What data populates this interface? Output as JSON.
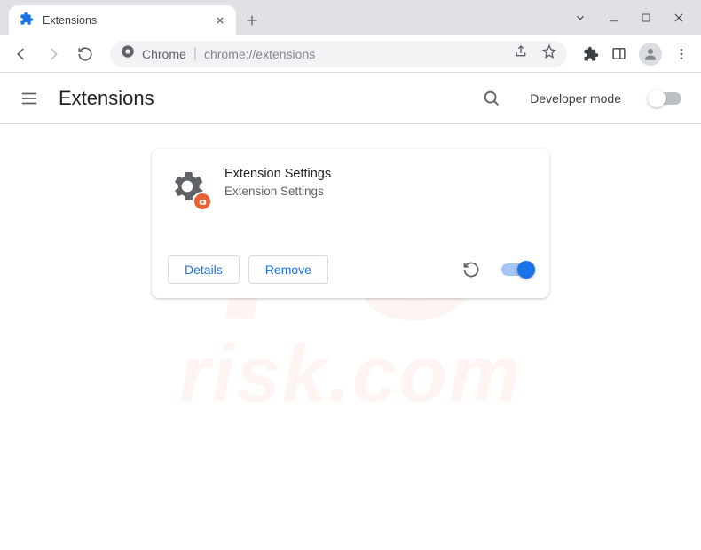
{
  "titlebar": {
    "tab_title": "Extensions"
  },
  "omnibox": {
    "scheme_label": "Chrome",
    "url_path": "chrome://extensions"
  },
  "page": {
    "title": "Extensions",
    "dev_mode_label": "Developer mode",
    "dev_mode_on": false
  },
  "extension": {
    "name": "Extension Settings",
    "description": "Extension Settings",
    "details_label": "Details",
    "remove_label": "Remove",
    "enabled": true
  }
}
